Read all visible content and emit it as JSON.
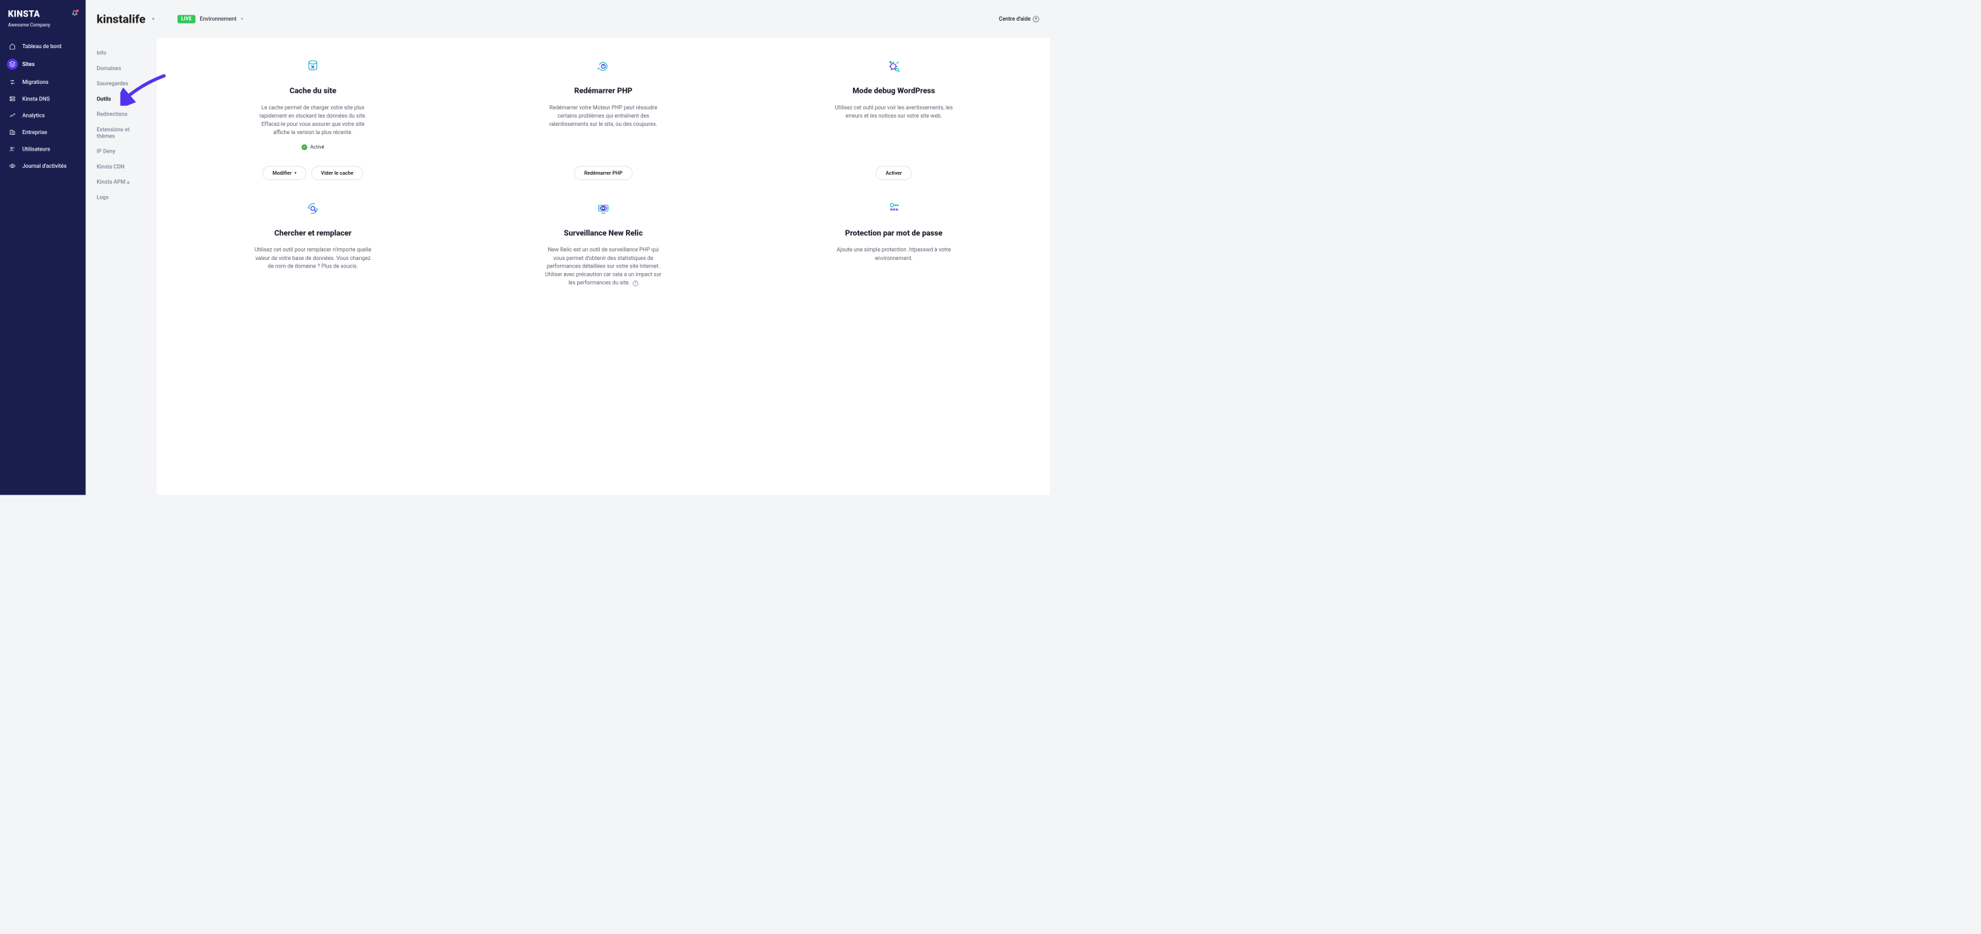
{
  "brand": "KINSTA",
  "company": "Awesome Company",
  "sidebar": {
    "items": [
      {
        "label": "Tableau de bord",
        "icon": "home"
      },
      {
        "label": "Sites",
        "icon": "layers",
        "active": true
      },
      {
        "label": "Migrations",
        "icon": "migrate"
      },
      {
        "label": "Kinsta DNS",
        "icon": "dns"
      },
      {
        "label": "Analytics",
        "icon": "analytics"
      },
      {
        "label": "Entreprise",
        "icon": "company"
      },
      {
        "label": "Utilisateurs",
        "icon": "users"
      },
      {
        "label": "Journal d'activités",
        "icon": "activity"
      }
    ]
  },
  "header": {
    "site_name": "kinstalife",
    "live_badge": "LIVE",
    "environment_label": "Environnement",
    "help": "Centre d'aide"
  },
  "subnav": {
    "items": [
      {
        "label": "Info"
      },
      {
        "label": "Domaines"
      },
      {
        "label": "Sauvegardes"
      },
      {
        "label": "Outils",
        "active": true
      },
      {
        "label": "Redirections"
      },
      {
        "label": "Extensions et thèmes"
      },
      {
        "label": "IP Deny"
      },
      {
        "label": "Kinsta CDN"
      },
      {
        "label": "Kinsta APM",
        "badge": true
      },
      {
        "label": "Logs"
      }
    ]
  },
  "tools_row1": [
    {
      "title": "Cache du site",
      "desc": "Le cache permet de charger votre site plus rapidement en stockant les données du site. Effacez-le pour vous assurer que votre site affiche la version la plus récente.",
      "status": "Activé",
      "actions": [
        "Modifier",
        "Vider le cache"
      ]
    },
    {
      "title": "Redémarrer PHP",
      "desc": "Redémarrer votre Moteur PHP peut résoudre certains problèmes qui entraînent des ralentissements sur le site, ou des coupures.",
      "actions": [
        "Redémarrer PHP"
      ]
    },
    {
      "title": "Mode debug WordPress",
      "desc": "Utilisez cet outil pour voir les avertissements, les erreurs et les notices sur votre site web.",
      "actions": [
        "Activer"
      ]
    }
  ],
  "tools_row2": [
    {
      "title": "Chercher et remplacer",
      "desc": "Utilisez cet outil pour remplacer n'importe quelle valeur de votre base de données. Vous changez de nom de domaine ? Plus de soucis."
    },
    {
      "title": "Surveillance New Relic",
      "desc": "New Relic est un outil de surveillance PHP qui vous permet d'obtenir des statistiques de performances détaillées sur votre site Internet. Utiliser avec précaution car cela a un impact sur les performances du site.",
      "info_icon": true
    },
    {
      "title": "Protection par mot de passe",
      "desc": "Ajoute une simple protection .htpasswd à votre environnement."
    }
  ],
  "colors": {
    "accent": "#5333ed",
    "teal": "#1fbec7",
    "green": "#4caf50"
  }
}
